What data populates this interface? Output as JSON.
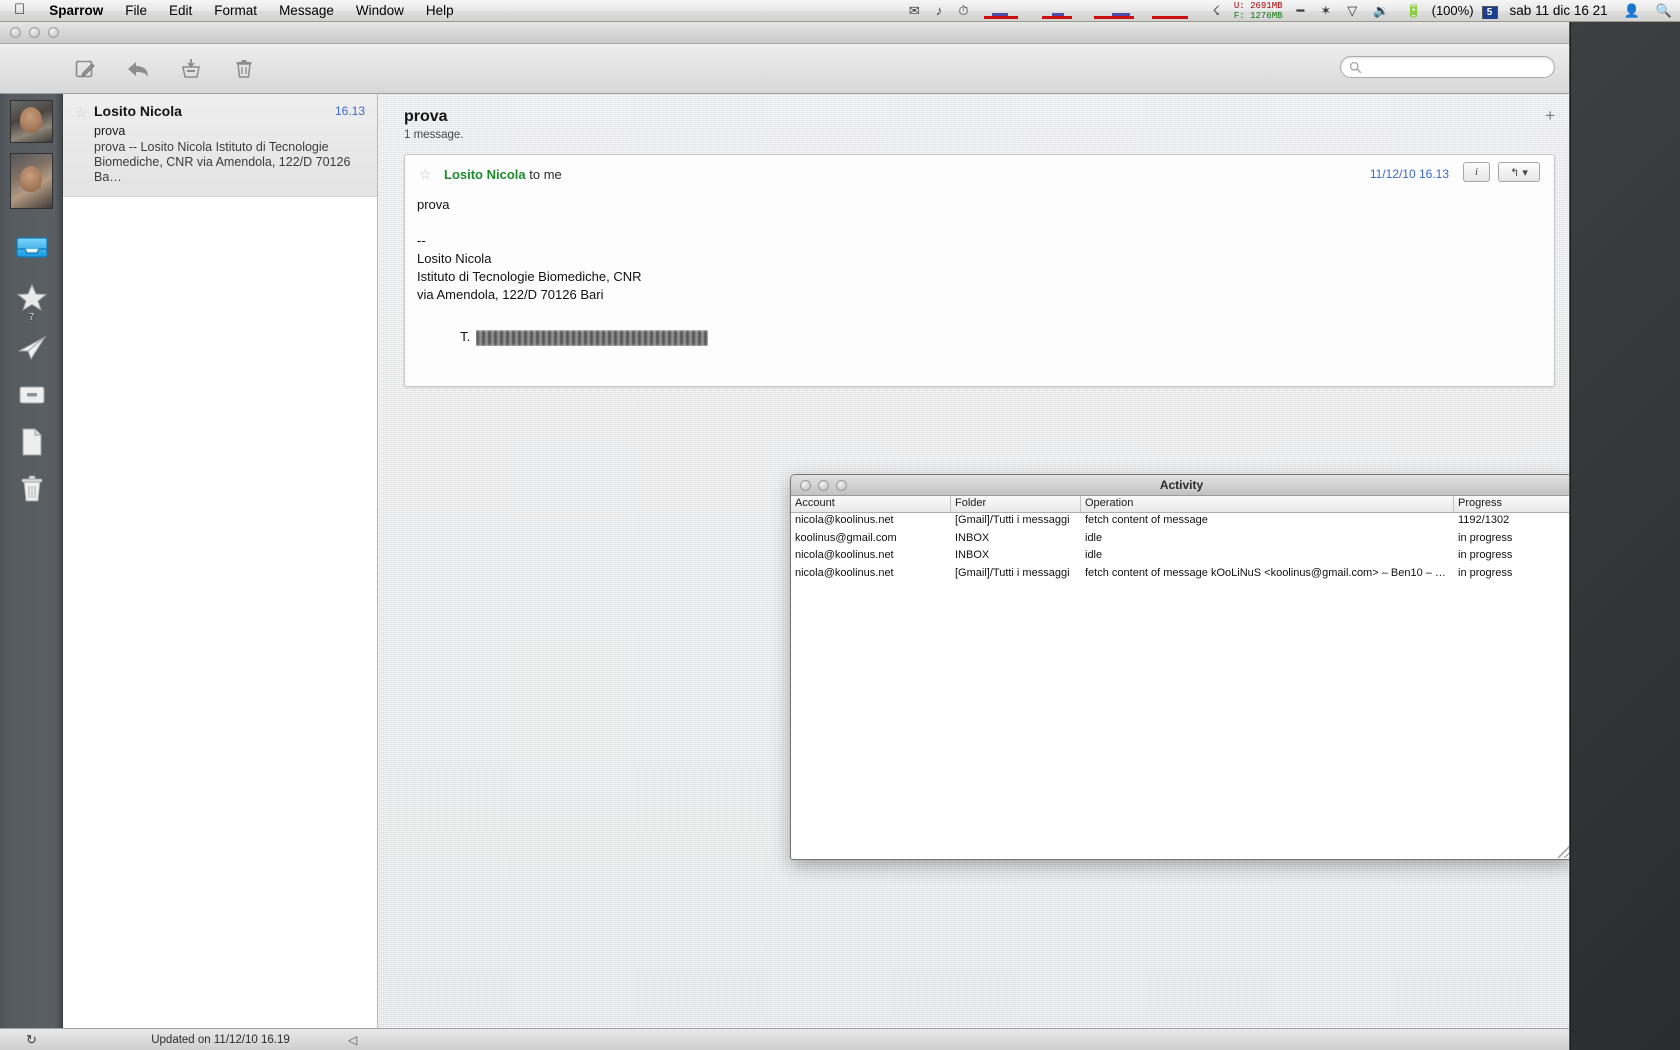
{
  "menubar": {
    "apple": "apple-logo",
    "items": [
      "Sparrow",
      "File",
      "Edit",
      "Format",
      "Message",
      "Window",
      "Help"
    ],
    "memory": {
      "used": "U: 2691MB",
      "free": "F: 1276MB"
    },
    "battery": "(100%)",
    "keyboard_flag": "5",
    "clock": "sab 11 dic  16 21"
  },
  "toolbar": {
    "compose": "compose-icon",
    "reply": "reply-icon",
    "archive": "archive-icon",
    "delete": "trash-icon",
    "search_placeholder": ""
  },
  "sidebar": {
    "items": [
      {
        "name": "inbox",
        "badge": ""
      },
      {
        "name": "starred",
        "badge": "7"
      },
      {
        "name": "sent",
        "badge": ""
      },
      {
        "name": "archive",
        "badge": ""
      },
      {
        "name": "drafts",
        "badge": ""
      },
      {
        "name": "trash",
        "badge": ""
      }
    ]
  },
  "message_list": [
    {
      "from": "Losito Nicola",
      "time": "16.13",
      "subject": "prova",
      "snippet": "prova -- Losito Nicola Istituto di Tecnologie Biomediche, CNR via Amendola, 122/D 70126 Ba…"
    }
  ],
  "conversation": {
    "title": "prova",
    "count": "1 message.",
    "add_label": "+",
    "message": {
      "sender": "Losito Nicola",
      "recipient": " to me",
      "date": "11/12/10 16.13",
      "info_label": "i",
      "reply_label": "↰ ▾",
      "body_lines": [
        "prova",
        "",
        "--",
        "Losito Nicola",
        "Istituto di Tecnologie Biomediche, CNR",
        "via Amendola, 122/D 70126 Bari"
      ],
      "phone_prefix": "T. "
    }
  },
  "activity_window": {
    "title": "Activity",
    "columns": [
      "Account",
      "Folder",
      "Operation",
      "Progress"
    ],
    "rows": [
      {
        "account": "nicola@koolinus.net",
        "folder": "[Gmail]/Tutti i messaggi",
        "operation": "fetch content of message",
        "progress": "1192/1302"
      },
      {
        "account": "koolinus@gmail.com",
        "folder": "INBOX",
        "operation": "idle",
        "progress": "in progress"
      },
      {
        "account": "nicola@koolinus.net",
        "folder": "INBOX",
        "operation": "idle",
        "progress": "in progress"
      },
      {
        "account": "nicola@koolinus.net",
        "folder": "[Gmail]/Tutti i messaggi",
        "operation": "fetch content of message kOoLiNuS <koolinus@gmail.com> – Ben10 – …",
        "progress": "in progress"
      }
    ]
  },
  "statusbar": {
    "refresh": "↻",
    "updated": "Updated on 11/12/10 16.19",
    "collapse": "◁"
  },
  "colors": {
    "accent_blue": "#3a68c8",
    "sender_green": "#1d8a2e",
    "inbox_blue": "#34b3f1"
  }
}
